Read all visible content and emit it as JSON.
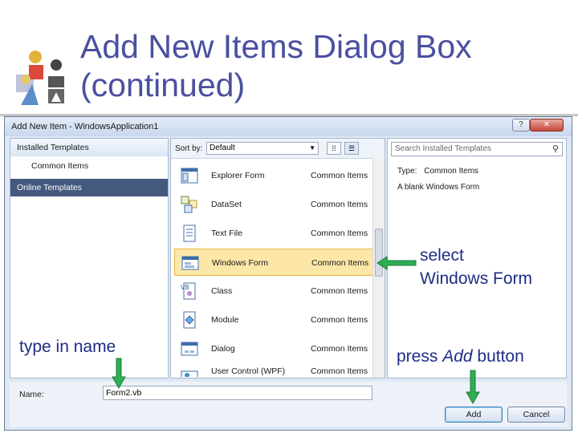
{
  "slide": {
    "title_line1": "Add New Items Dialog Box",
    "title_line2": "(continued)"
  },
  "dialog": {
    "window_title": "Add New Item - WindowsApplication1",
    "help_icon_glyph": "?",
    "close_icon_glyph": "✕",
    "left_nav": {
      "installed_templates": "Installed Templates",
      "common_items": "Common Items",
      "online_templates": "Online Templates"
    },
    "sort": {
      "label": "Sort by:",
      "value": "Default"
    },
    "templates": [
      {
        "name": "Explorer Form",
        "category": "Common Items",
        "icon": "explorer-form-icon",
        "selected": false
      },
      {
        "name": "DataSet",
        "category": "Common Items",
        "icon": "dataset-icon",
        "selected": false
      },
      {
        "name": "Text File",
        "category": "Common Items",
        "icon": "text-file-icon",
        "selected": false
      },
      {
        "name": "Windows Form",
        "category": "Common Items",
        "icon": "windows-form-icon",
        "selected": true
      },
      {
        "name": "Class",
        "category": "Common Items",
        "icon": "class-icon",
        "selected": false
      },
      {
        "name": "Module",
        "category": "Common Items",
        "icon": "module-icon",
        "selected": false
      },
      {
        "name": "Dialog",
        "category": "Common Items",
        "icon": "dialog-icon",
        "selected": false
      },
      {
        "name": "User Control (WPF)",
        "category": "Common Items",
        "icon": "user-control-icon",
        "selected": false
      }
    ],
    "search": {
      "placeholder": "Search Installed Templates"
    },
    "details": {
      "type_label": "Type:",
      "type_value": "Common Items",
      "description": "A blank Windows Form"
    },
    "name_field": {
      "label": "Name:",
      "value": "Form2.vb"
    },
    "buttons": {
      "add": "Add",
      "cancel": "Cancel"
    }
  },
  "annotations": {
    "select_line1": "select",
    "select_line2": "Windows Form",
    "type_in_name": "type in name",
    "press_prefix": "press ",
    "press_add": "Add",
    "press_suffix": " button"
  },
  "colors": {
    "title_color": "#4a4fa0",
    "annotation_color": "#1f2c87",
    "arrow_color": "#2fae53",
    "selected_row": "#fce7a8",
    "online_templates_bg": "#43597e"
  }
}
